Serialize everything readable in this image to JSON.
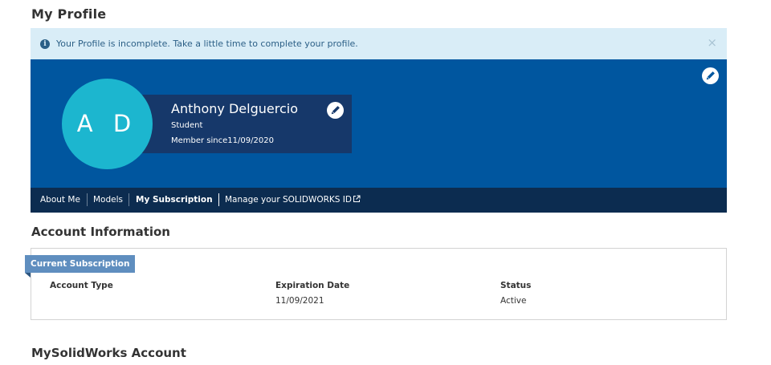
{
  "page": {
    "title": "My Profile"
  },
  "alert": {
    "message": "Your Profile is incomplete. Take a little time to complete your profile.",
    "close": "×"
  },
  "profile": {
    "initials": "A D",
    "name": "Anthony Delguercio",
    "role": "Student",
    "member_since": "Member since11/09/2020"
  },
  "subnav": {
    "items": [
      {
        "label": "About Me"
      },
      {
        "label": "Models"
      },
      {
        "label": "My Subscription"
      },
      {
        "label": "Manage your SOLIDWORKS ID"
      }
    ]
  },
  "account_info": {
    "title": "Account Information",
    "ribbon": "Current Subscription",
    "columns": [
      {
        "header": "Account Type",
        "value": ""
      },
      {
        "header": "Expiration Date",
        "value": "11/09/2021"
      },
      {
        "header": "Status",
        "value": "Active"
      }
    ]
  },
  "mysolidworks": {
    "title": "MySolidWorks Account"
  },
  "colors": {
    "banner": "#00569f",
    "avatar": "#1cb6cf",
    "name_card": "#16386a",
    "subnav": "#0c2c50",
    "alert_bg": "#d9edf7",
    "ribbon": "#5f8ebf"
  },
  "icons": [
    "info-icon",
    "close-icon",
    "pencil-icon",
    "external-link-icon"
  ]
}
